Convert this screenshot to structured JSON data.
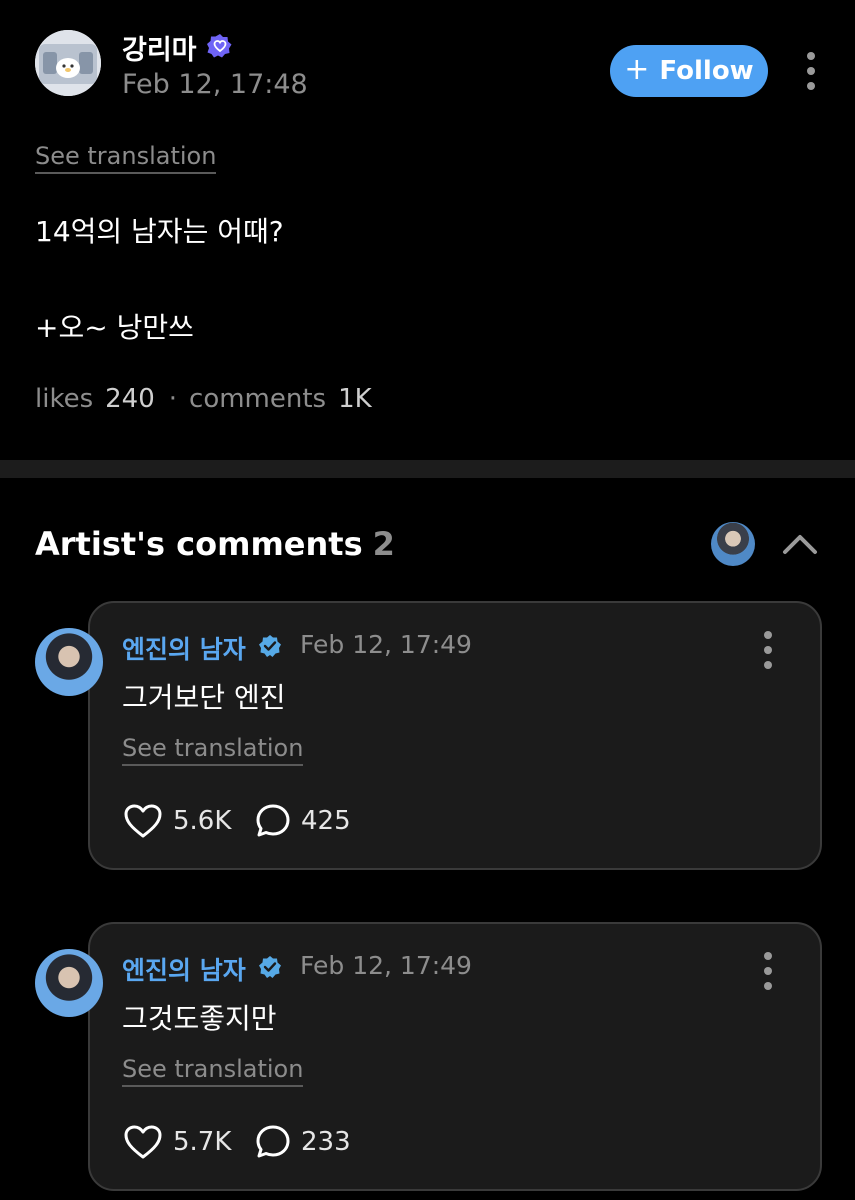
{
  "post": {
    "username": "강리마",
    "time": "Feb 12, 17:48",
    "follow_label": "Follow",
    "follow_plus": "+",
    "see_translation": "See translation",
    "body_line1": "14억의 남자는 어때?",
    "body_line2": "+오~ 낭만쓰",
    "likes_label": "likes",
    "likes_count": "240",
    "separator": "·",
    "comments_label": "comments",
    "comments_count": "1K"
  },
  "artist_comments": {
    "title": "Artist's comments",
    "count": "2",
    "items": [
      {
        "author": "엔진의 남자",
        "time": "Feb 12, 17:49",
        "text": "그거보단 엔진",
        "see_translation": "See translation",
        "likes": "5.6K",
        "replies": "425"
      },
      {
        "author": "엔진의 남자",
        "time": "Feb 12, 17:49",
        "text": "그것도좋지만",
        "see_translation": "See translation",
        "likes": "5.7K",
        "replies": "233"
      }
    ]
  },
  "colors": {
    "background": "#000000",
    "accent": "#4ea1f3",
    "artist_name": "#5aa7f0",
    "card": "#1b1b1b",
    "muted": "#8d8d8d"
  },
  "icons": [
    "verified-badge-icon",
    "plus-icon",
    "more-vertical-icon",
    "chevron-up-icon",
    "heart-icon",
    "comment-bubble-icon"
  ]
}
